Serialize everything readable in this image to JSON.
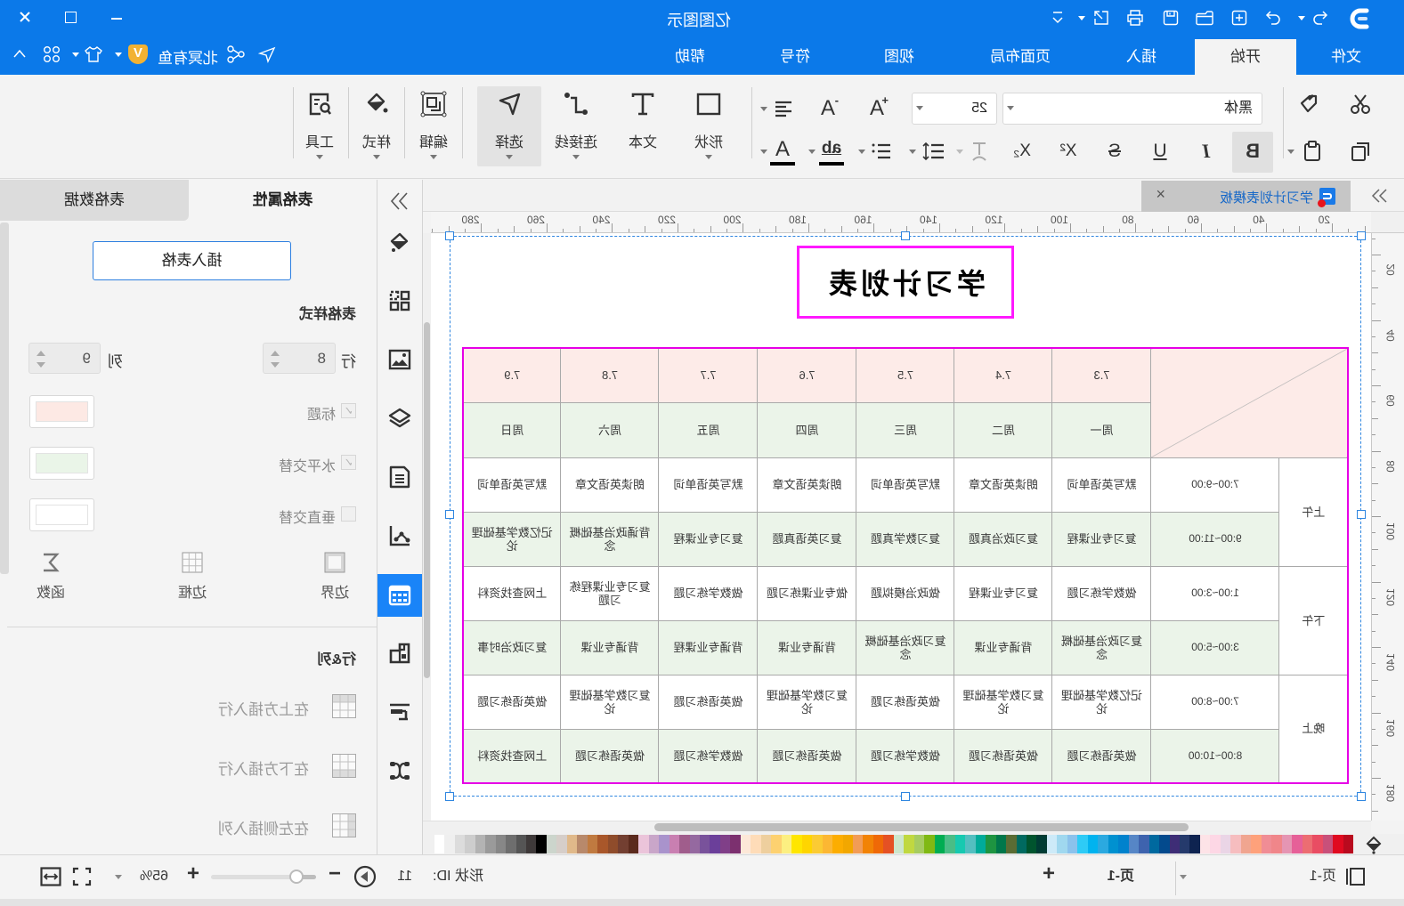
{
  "titlebar": {
    "title": "亿图图示",
    "quick_access": [
      "undo",
      "redo",
      "new",
      "open",
      "save",
      "print",
      "export",
      "customize"
    ],
    "window_controls": [
      "minimize",
      "maximize",
      "close"
    ]
  },
  "menu": {
    "tabs": [
      "文件",
      "开始",
      "插入",
      "页面布局",
      "视图",
      "符号",
      "帮助"
    ],
    "active_tab": "开始",
    "user_name": "北冥有鱼",
    "vip_badge": "V"
  },
  "ribbon": {
    "font_name": "黑体",
    "font_size": "25",
    "grow_font": "A",
    "shrink_font": "A",
    "bold": "B",
    "italic": "I",
    "underline": "U",
    "strike": "S",
    "superscript": "X²",
    "subscript": "X₂",
    "highlight": "ab",
    "font_color": "A",
    "large_buttons": {
      "shape": "形状",
      "text": "文本",
      "connector": "连接线",
      "select": "选择",
      "edit": "编辑",
      "style": "样式",
      "tools": "工具"
    },
    "active_button": "选择"
  },
  "doc_tab": {
    "label": "学习计划表模板",
    "close": "×"
  },
  "ruler": {
    "h_labels": [
      20,
      40,
      60,
      80,
      100,
      120,
      140,
      160,
      180,
      200,
      220,
      240,
      260,
      280
    ],
    "v_labels": [
      20,
      40,
      60,
      80,
      100,
      120,
      140,
      160,
      180
    ]
  },
  "canvas": {
    "title": "学习计划表",
    "table": {
      "dates": [
        "7.3",
        "7.4",
        "7.5",
        "7.6",
        "7.7",
        "7.8",
        "7.9"
      ],
      "weekdays": [
        "周一",
        "周二",
        "周三",
        "周四",
        "周五",
        "周六",
        "周日"
      ],
      "sections": [
        "上午",
        "下午",
        "晚上"
      ],
      "rows": [
        {
          "time": "7:00~9:00",
          "cells": [
            "默写英语单词",
            "朗读英语文章",
            "默写英语单词",
            "朗读英语文章",
            "默写英语单词",
            "朗读英语文章",
            "默写英语单词"
          ]
        },
        {
          "time": "9:00~11:00",
          "cells": [
            "复习专业课程",
            "复习政治真题",
            "复习数学真题",
            "复习英语真题",
            "复习专业课程",
            "背诵政治基础概念",
            "记忆数学基础理论"
          ]
        },
        {
          "time": "1:00~3:00",
          "cells": [
            "做数学练习题",
            "复习专业课程",
            "做政治模拟题",
            "做专业课练习题",
            "做数学练习题",
            "复习专业课程练习题",
            "上网查找资料"
          ]
        },
        {
          "time": "3:00~5:00",
          "cells": [
            "复习政治基础概念",
            "背诵专业课",
            "复习政治基础概念",
            "背诵专业课",
            "背诵专业课程",
            "背诵专业课",
            "复习政治时事"
          ]
        },
        {
          "time": "7:00~8:00",
          "cells": [
            "记忆数学基础理论",
            "复习数学基础理论",
            "做英语练习题",
            "复习数学基础理论",
            "做英语练习题",
            "复习数学基础理论",
            "做英语练习题"
          ]
        },
        {
          "time": "8:00~10:00",
          "cells": [
            "做英语练习题",
            "做英语练习题",
            "做数学练习题",
            "做英语练习题",
            "做数学练习题",
            "做英语练习题",
            "上网查找资料"
          ]
        }
      ]
    }
  },
  "palette": [
    "#b90a1e",
    "#e00a20",
    "#c8507a",
    "#e94d63",
    "#ec6d72",
    "#e66098",
    "#e595b3",
    "#f0868a",
    "#f08d95",
    "#fea17b",
    "#f0a590",
    "#f6bdbf",
    "#ead5e6",
    "#fdd7e5",
    "#fde3e7",
    "#0e2350",
    "#253a6c",
    "#3e2d76",
    "#034a8d",
    "#00699f",
    "#3e63ae",
    "#5686c6",
    "#0082cd",
    "#0091d0",
    "#2ba9e0",
    "#00b3ef",
    "#2ecbf6",
    "#8bc2ec",
    "#a0d8ef",
    "#cdeaf8",
    "#003c34",
    "#00542e",
    "#006a60",
    "#5a6c34",
    "#00774a",
    "#1e9441",
    "#00ab9a",
    "#53bfc0",
    "#17c9b0",
    "#4abd86",
    "#00ad52",
    "#80b913",
    "#a6cc60",
    "#c0d840",
    "#cde6cc",
    "#e55124",
    "#ef6907",
    "#f28305",
    "#f29c56",
    "#f2a700",
    "#fcad00",
    "#fcb733",
    "#fbcb33",
    "#ffd500",
    "#ffe600",
    "#fcef81",
    "#fdd170",
    "#eecf9e",
    "#fedcb8",
    "#fde8d8",
    "#7c306f",
    "#803f88",
    "#6b3f9a",
    "#79529b",
    "#9569a0",
    "#a05d8c",
    "#c97fb1",
    "#a993cc",
    "#c9a6c9",
    "#ebc4da",
    "#5b2a1d",
    "#733f31",
    "#8f4c2b",
    "#a9572a",
    "#c07a40",
    "#b8896b",
    "#e0b98a",
    "#d6cec9",
    "#ccd5cc",
    "#000000",
    "#3e3939",
    "#555555",
    "#6e6e6e",
    "#878787",
    "#9a9a9a",
    "#b3b3b3",
    "#cdcdcd",
    "#dcdcdc",
    "#efefef",
    "#ffffff"
  ],
  "sidebar_icons": [
    "fill",
    "symbols",
    "image",
    "layers",
    "page",
    "data-chart",
    "table",
    "plugin",
    "gantt",
    "mindmap"
  ],
  "active_sidebar_icon": "table",
  "panel": {
    "tabs": [
      "表格属性",
      "表格数据"
    ],
    "active_tab": "表格属性",
    "insert_table": "插入表格",
    "style_heading": "表格样式",
    "rows_label": "行",
    "rows_value": "8",
    "cols_label": "列",
    "cols_value": "9",
    "options": [
      {
        "label": "标题",
        "checked": true,
        "color": "#fde9e4"
      },
      {
        "label": "水平交替",
        "checked": true,
        "color": "#eaf5e8"
      },
      {
        "label": "垂直交替",
        "checked": false,
        "color": "#ffffff"
      }
    ],
    "check_mark": "✓",
    "tools": [
      "边界",
      "边框",
      "函数"
    ],
    "rowcol_heading": "行&列",
    "rowcol_actions": [
      "在上方插入行",
      "在下方插入行",
      "在左侧插入列"
    ]
  },
  "statusbar": {
    "page_list": "页-1",
    "active_page": "页-1",
    "add_page": "+",
    "shape_id_label": "形状 ID:",
    "shape_id": "11",
    "zoom_minus": "−",
    "zoom_plus": "+",
    "zoom": "65%",
    "zoom_slider_fraction": 0.19
  }
}
